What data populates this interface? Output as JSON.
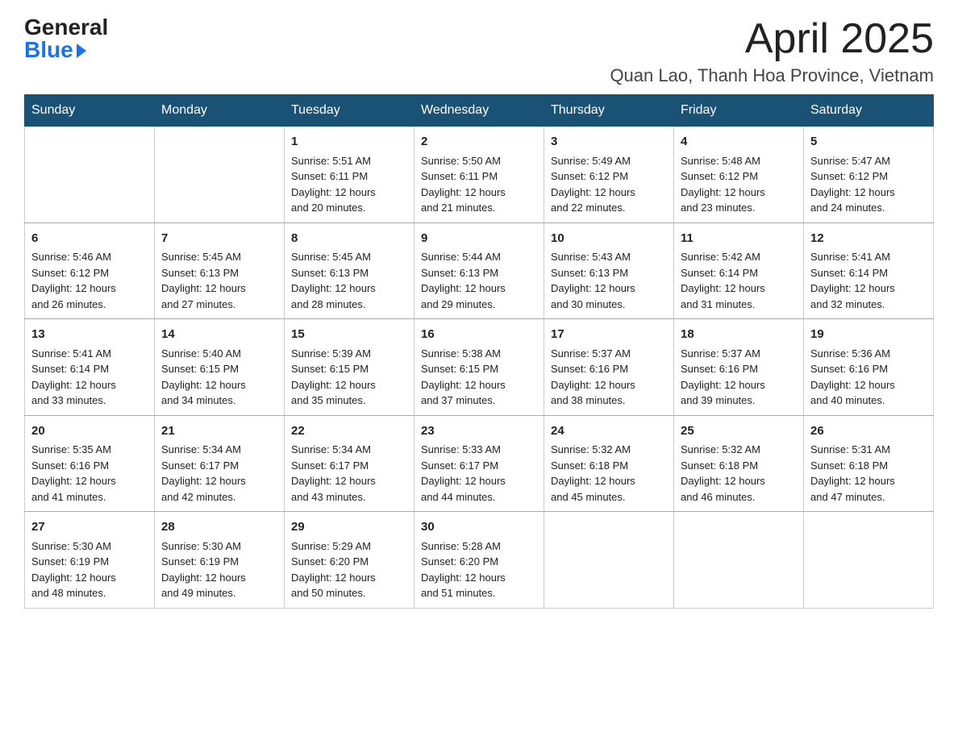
{
  "header": {
    "logo_general": "General",
    "logo_blue": "Blue",
    "month_title": "April 2025",
    "location": "Quan Lao, Thanh Hoa Province, Vietnam"
  },
  "calendar": {
    "days_of_week": [
      "Sunday",
      "Monday",
      "Tuesday",
      "Wednesday",
      "Thursday",
      "Friday",
      "Saturday"
    ],
    "weeks": [
      [
        {
          "day": "",
          "info": ""
        },
        {
          "day": "",
          "info": ""
        },
        {
          "day": "1",
          "info": "Sunrise: 5:51 AM\nSunset: 6:11 PM\nDaylight: 12 hours\nand 20 minutes."
        },
        {
          "day": "2",
          "info": "Sunrise: 5:50 AM\nSunset: 6:11 PM\nDaylight: 12 hours\nand 21 minutes."
        },
        {
          "day": "3",
          "info": "Sunrise: 5:49 AM\nSunset: 6:12 PM\nDaylight: 12 hours\nand 22 minutes."
        },
        {
          "day": "4",
          "info": "Sunrise: 5:48 AM\nSunset: 6:12 PM\nDaylight: 12 hours\nand 23 minutes."
        },
        {
          "day": "5",
          "info": "Sunrise: 5:47 AM\nSunset: 6:12 PM\nDaylight: 12 hours\nand 24 minutes."
        }
      ],
      [
        {
          "day": "6",
          "info": "Sunrise: 5:46 AM\nSunset: 6:12 PM\nDaylight: 12 hours\nand 26 minutes."
        },
        {
          "day": "7",
          "info": "Sunrise: 5:45 AM\nSunset: 6:13 PM\nDaylight: 12 hours\nand 27 minutes."
        },
        {
          "day": "8",
          "info": "Sunrise: 5:45 AM\nSunset: 6:13 PM\nDaylight: 12 hours\nand 28 minutes."
        },
        {
          "day": "9",
          "info": "Sunrise: 5:44 AM\nSunset: 6:13 PM\nDaylight: 12 hours\nand 29 minutes."
        },
        {
          "day": "10",
          "info": "Sunrise: 5:43 AM\nSunset: 6:13 PM\nDaylight: 12 hours\nand 30 minutes."
        },
        {
          "day": "11",
          "info": "Sunrise: 5:42 AM\nSunset: 6:14 PM\nDaylight: 12 hours\nand 31 minutes."
        },
        {
          "day": "12",
          "info": "Sunrise: 5:41 AM\nSunset: 6:14 PM\nDaylight: 12 hours\nand 32 minutes."
        }
      ],
      [
        {
          "day": "13",
          "info": "Sunrise: 5:41 AM\nSunset: 6:14 PM\nDaylight: 12 hours\nand 33 minutes."
        },
        {
          "day": "14",
          "info": "Sunrise: 5:40 AM\nSunset: 6:15 PM\nDaylight: 12 hours\nand 34 minutes."
        },
        {
          "day": "15",
          "info": "Sunrise: 5:39 AM\nSunset: 6:15 PM\nDaylight: 12 hours\nand 35 minutes."
        },
        {
          "day": "16",
          "info": "Sunrise: 5:38 AM\nSunset: 6:15 PM\nDaylight: 12 hours\nand 37 minutes."
        },
        {
          "day": "17",
          "info": "Sunrise: 5:37 AM\nSunset: 6:16 PM\nDaylight: 12 hours\nand 38 minutes."
        },
        {
          "day": "18",
          "info": "Sunrise: 5:37 AM\nSunset: 6:16 PM\nDaylight: 12 hours\nand 39 minutes."
        },
        {
          "day": "19",
          "info": "Sunrise: 5:36 AM\nSunset: 6:16 PM\nDaylight: 12 hours\nand 40 minutes."
        }
      ],
      [
        {
          "day": "20",
          "info": "Sunrise: 5:35 AM\nSunset: 6:16 PM\nDaylight: 12 hours\nand 41 minutes."
        },
        {
          "day": "21",
          "info": "Sunrise: 5:34 AM\nSunset: 6:17 PM\nDaylight: 12 hours\nand 42 minutes."
        },
        {
          "day": "22",
          "info": "Sunrise: 5:34 AM\nSunset: 6:17 PM\nDaylight: 12 hours\nand 43 minutes."
        },
        {
          "day": "23",
          "info": "Sunrise: 5:33 AM\nSunset: 6:17 PM\nDaylight: 12 hours\nand 44 minutes."
        },
        {
          "day": "24",
          "info": "Sunrise: 5:32 AM\nSunset: 6:18 PM\nDaylight: 12 hours\nand 45 minutes."
        },
        {
          "day": "25",
          "info": "Sunrise: 5:32 AM\nSunset: 6:18 PM\nDaylight: 12 hours\nand 46 minutes."
        },
        {
          "day": "26",
          "info": "Sunrise: 5:31 AM\nSunset: 6:18 PM\nDaylight: 12 hours\nand 47 minutes."
        }
      ],
      [
        {
          "day": "27",
          "info": "Sunrise: 5:30 AM\nSunset: 6:19 PM\nDaylight: 12 hours\nand 48 minutes."
        },
        {
          "day": "28",
          "info": "Sunrise: 5:30 AM\nSunset: 6:19 PM\nDaylight: 12 hours\nand 49 minutes."
        },
        {
          "day": "29",
          "info": "Sunrise: 5:29 AM\nSunset: 6:20 PM\nDaylight: 12 hours\nand 50 minutes."
        },
        {
          "day": "30",
          "info": "Sunrise: 5:28 AM\nSunset: 6:20 PM\nDaylight: 12 hours\nand 51 minutes."
        },
        {
          "day": "",
          "info": ""
        },
        {
          "day": "",
          "info": ""
        },
        {
          "day": "",
          "info": ""
        }
      ]
    ]
  }
}
